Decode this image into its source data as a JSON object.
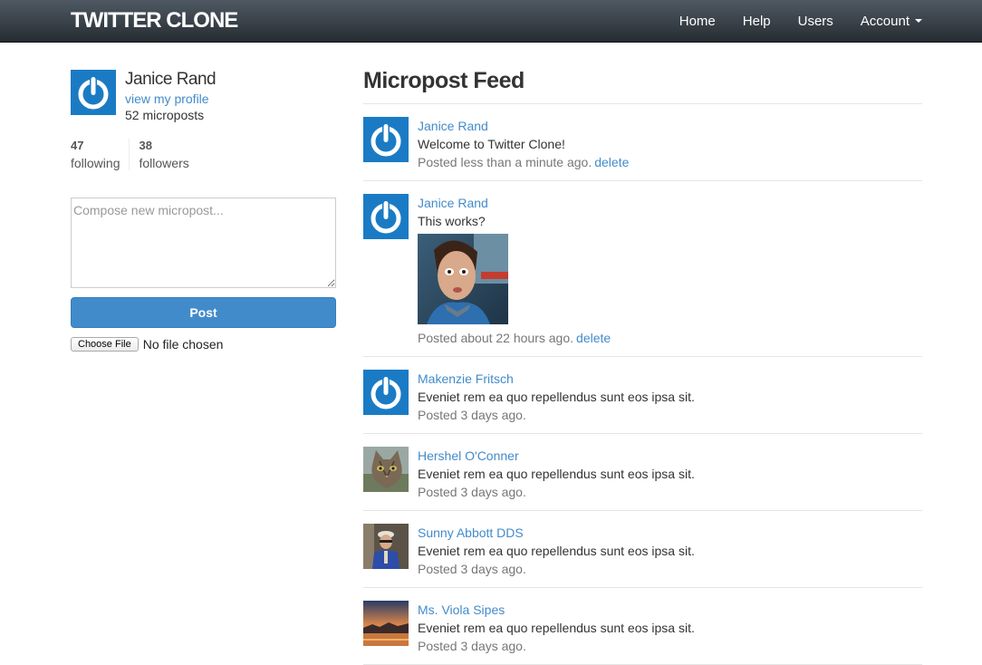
{
  "nav": {
    "logo": "TWITTER CLONE",
    "home": "Home",
    "help": "Help",
    "users": "Users",
    "account": "Account"
  },
  "sidebar": {
    "user_name": "Janice Rand",
    "profile_link": "view my profile",
    "micropost_count": "52 microposts",
    "following_count": "47",
    "following_label": "following",
    "followers_count": "38",
    "followers_label": "followers",
    "compose_placeholder": "Compose new micropost...",
    "post_button": "Post",
    "choose_file": "Choose File",
    "file_status": "No file chosen"
  },
  "feed": {
    "title": "Micropost Feed",
    "posts": [
      {
        "user": "Janice Rand",
        "content": "Welcome to Twitter Clone!",
        "timestamp": "Posted less than a minute ago.",
        "delete": "delete",
        "avatar": "power-icon"
      },
      {
        "user": "Janice Rand",
        "content": "This works?",
        "timestamp": "Posted about 22 hours ago.",
        "delete": "delete",
        "avatar": "power-icon"
      },
      {
        "user": "Makenzie Fritsch",
        "content": "Eveniet rem ea quo repellendus sunt eos ipsa sit.",
        "timestamp": "Posted 3 days ago.",
        "avatar": "power-icon"
      },
      {
        "user": "Hershel O'Conner",
        "content": "Eveniet rem ea quo repellendus sunt eos ipsa sit.",
        "timestamp": "Posted 3 days ago.",
        "avatar": "cat-photo"
      },
      {
        "user": "Sunny Abbott DDS",
        "content": "Eveniet rem ea quo repellendus sunt eos ipsa sit.",
        "timestamp": "Posted 3 days ago.",
        "avatar": "person-photo"
      },
      {
        "user": "Ms. Viola Sipes",
        "content": "Eveniet rem ea quo repellendus sunt eos ipsa sit.",
        "timestamp": "Posted 3 days ago.",
        "avatar": "sunset-photo"
      }
    ]
  },
  "colors": {
    "link": "#428bca",
    "button": "#428bca",
    "gravatar_blue": "#1a7bc4",
    "nav_top": "#4f5963",
    "nav_bottom": "#262c33"
  }
}
